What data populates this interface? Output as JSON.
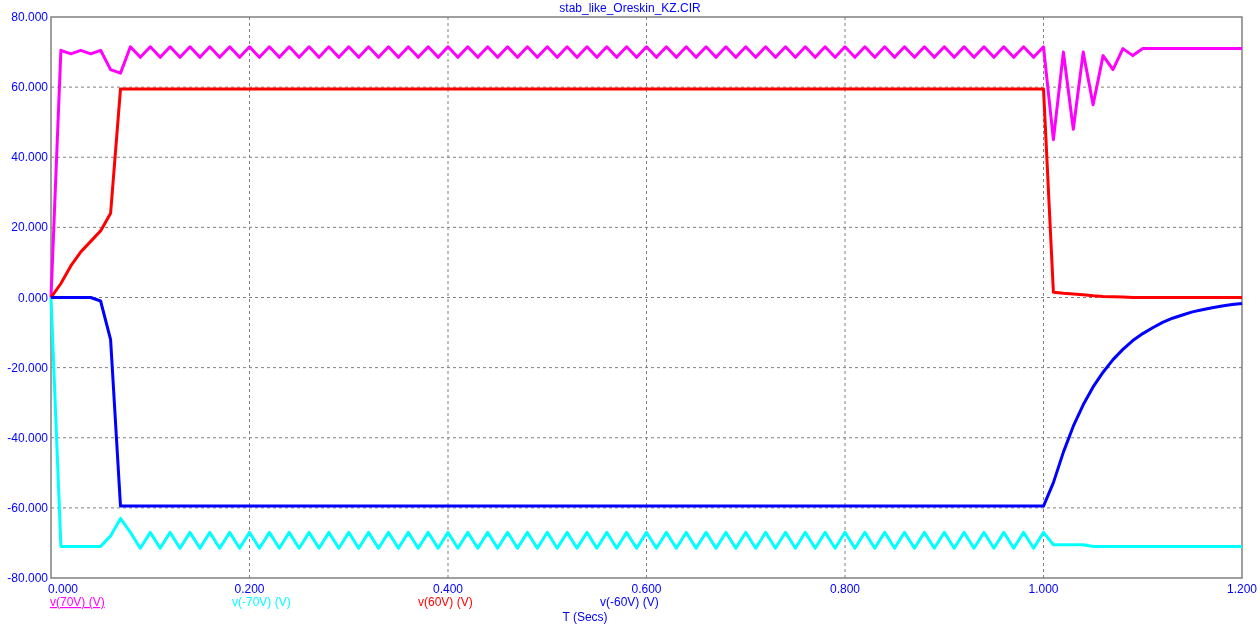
{
  "chart": {
    "chart_data": {
      "type": "line",
      "title": "stab_like_Oreskin_KZ.CIR",
      "xlabel": "T (Secs)",
      "x": [
        0,
        0.01,
        0.02,
        0.03,
        0.04,
        0.05,
        0.06,
        0.07,
        0.08,
        0.09,
        0.1,
        0.11,
        0.12,
        0.13,
        0.14,
        0.15,
        0.16,
        0.17,
        0.18,
        0.19,
        0.2,
        0.21,
        0.22,
        0.23,
        0.24,
        0.25,
        0.26,
        0.27,
        0.28,
        0.29,
        0.3,
        0.31,
        0.32,
        0.33,
        0.34,
        0.35,
        0.36,
        0.37,
        0.38,
        0.39,
        0.4,
        0.41,
        0.42,
        0.43,
        0.44,
        0.45,
        0.46,
        0.47,
        0.48,
        0.49,
        0.5,
        0.51,
        0.52,
        0.53,
        0.54,
        0.55,
        0.56,
        0.57,
        0.58,
        0.59,
        0.6,
        0.61,
        0.62,
        0.63,
        0.64,
        0.65,
        0.66,
        0.67,
        0.68,
        0.69,
        0.7,
        0.71,
        0.72,
        0.73,
        0.74,
        0.75,
        0.76,
        0.77,
        0.78,
        0.79,
        0.8,
        0.81,
        0.82,
        0.83,
        0.84,
        0.85,
        0.86,
        0.87,
        0.88,
        0.89,
        0.9,
        0.91,
        0.92,
        0.93,
        0.94,
        0.95,
        0.96,
        0.97,
        0.98,
        0.99,
        1.0,
        1.01,
        1.02,
        1.03,
        1.04,
        1.05,
        1.06,
        1.07,
        1.08,
        1.09,
        1.1,
        1.11,
        1.12,
        1.13,
        1.14,
        1.15,
        1.16,
        1.17,
        1.18,
        1.19,
        1.2
      ],
      "series": [
        {
          "name": "v(70V) (V)",
          "color": "#ff00ff",
          "values": [
            0,
            70.5,
            69.5,
            70.5,
            69.5,
            70.5,
            65,
            64,
            71.5,
            68.5,
            71.5,
            68.5,
            71.5,
            68.5,
            71.5,
            68.5,
            71.5,
            68.5,
            71.5,
            68.5,
            71.5,
            68.5,
            71.5,
            68.5,
            71.5,
            68.5,
            71.5,
            68.5,
            71.5,
            68.5,
            71.5,
            68.5,
            71.5,
            68.5,
            71.5,
            68.5,
            71.5,
            68.5,
            71.5,
            68.5,
            71.5,
            68.5,
            71.5,
            68.5,
            71.5,
            68.5,
            71.5,
            68.5,
            71.5,
            68.5,
            71.5,
            68.5,
            71.5,
            68.5,
            71.5,
            68.5,
            71.5,
            68.5,
            71.5,
            68.5,
            71.5,
            68.5,
            71.5,
            68.5,
            71.5,
            68.5,
            71.5,
            68.5,
            71.5,
            68.5,
            71.5,
            68.5,
            71.5,
            68.5,
            71.5,
            68.5,
            71.5,
            68.5,
            71.5,
            68.5,
            71.5,
            68.5,
            71.5,
            68.5,
            71.5,
            68.5,
            71.5,
            68.5,
            71.5,
            68.5,
            71.5,
            68.5,
            71.5,
            68.5,
            71.5,
            68.5,
            71.5,
            68.5,
            71.5,
            68.5,
            71.5,
            45,
            70,
            48,
            70,
            55,
            69,
            65,
            71,
            69,
            71,
            71,
            71,
            71,
            71,
            71,
            71,
            71,
            71,
            71,
            71
          ]
        },
        {
          "name": "v(-70V) (V)",
          "color": "#00ffff",
          "values": [
            0,
            -71,
            -71,
            -71,
            -71,
            -71,
            -68,
            -63,
            -67,
            -71.5,
            -67,
            -71.5,
            -67,
            -71.5,
            -67,
            -71.5,
            -67,
            -71.5,
            -67,
            -71.5,
            -67,
            -71.5,
            -67,
            -71.5,
            -67,
            -71.5,
            -67,
            -71.5,
            -67,
            -71.5,
            -67,
            -71.5,
            -67,
            -71.5,
            -67,
            -71.5,
            -67,
            -71.5,
            -67,
            -71.5,
            -67,
            -71.5,
            -67,
            -71.5,
            -67,
            -71.5,
            -67,
            -71.5,
            -67,
            -71.5,
            -67,
            -71.5,
            -67,
            -71.5,
            -67,
            -71.5,
            -67,
            -71.5,
            -67,
            -71.5,
            -67,
            -71.5,
            -67,
            -71.5,
            -67,
            -71.5,
            -67,
            -71.5,
            -67,
            -71.5,
            -67,
            -71.5,
            -67,
            -71.5,
            -67,
            -71.5,
            -67,
            -71.5,
            -67,
            -71.5,
            -67,
            -71.5,
            -67,
            -71.5,
            -67,
            -71.5,
            -67,
            -71.5,
            -67,
            -71.5,
            -67,
            -71.5,
            -67,
            -71.5,
            -67,
            -71.5,
            -67,
            -71.5,
            -67,
            -71.5,
            -67,
            -70.5,
            -70.5,
            -70.5,
            -70.5,
            -71,
            -71,
            -71,
            -71,
            -71,
            -71,
            -71,
            -71,
            -71,
            -71,
            -71,
            -71,
            -71,
            -71,
            -71,
            -71
          ]
        },
        {
          "name": "v(60V) (V)",
          "color": "#ff0000",
          "values": [
            0,
            4,
            9,
            13,
            16,
            19,
            24,
            59.5,
            59.5,
            59.5,
            59.5,
            59.5,
            59.5,
            59.5,
            59.5,
            59.5,
            59.5,
            59.5,
            59.5,
            59.5,
            59.5,
            59.5,
            59.5,
            59.5,
            59.5,
            59.5,
            59.5,
            59.5,
            59.5,
            59.5,
            59.5,
            59.5,
            59.5,
            59.5,
            59.5,
            59.5,
            59.5,
            59.5,
            59.5,
            59.5,
            59.5,
            59.5,
            59.5,
            59.5,
            59.5,
            59.5,
            59.5,
            59.5,
            59.5,
            59.5,
            59.5,
            59.5,
            59.5,
            59.5,
            59.5,
            59.5,
            59.5,
            59.5,
            59.5,
            59.5,
            59.5,
            59.5,
            59.5,
            59.5,
            59.5,
            59.5,
            59.5,
            59.5,
            59.5,
            59.5,
            59.5,
            59.5,
            59.5,
            59.5,
            59.5,
            59.5,
            59.5,
            59.5,
            59.5,
            59.5,
            59.5,
            59.5,
            59.5,
            59.5,
            59.5,
            59.5,
            59.5,
            59.5,
            59.5,
            59.5,
            59.5,
            59.5,
            59.5,
            59.5,
            59.5,
            59.5,
            59.5,
            59.5,
            59.5,
            59.5,
            59.5,
            1.5,
            1.2,
            1,
            0.8,
            0.5,
            0.3,
            0.2,
            0.1,
            0,
            0,
            0,
            0,
            0,
            0,
            0,
            0,
            0,
            0,
            0,
            0
          ]
        },
        {
          "name": "v(-60V) (V)",
          "color": "#0000ff",
          "values": [
            0,
            0,
            0,
            0,
            0,
            -1,
            -12,
            -59.5,
            -59.5,
            -59.5,
            -59.5,
            -59.5,
            -59.5,
            -59.5,
            -59.5,
            -59.5,
            -59.5,
            -59.5,
            -59.5,
            -59.5,
            -59.5,
            -59.5,
            -59.5,
            -59.5,
            -59.5,
            -59.5,
            -59.5,
            -59.5,
            -59.5,
            -59.5,
            -59.5,
            -59.5,
            -59.5,
            -59.5,
            -59.5,
            -59.5,
            -59.5,
            -59.5,
            -59.5,
            -59.5,
            -59.5,
            -59.5,
            -59.5,
            -59.5,
            -59.5,
            -59.5,
            -59.5,
            -59.5,
            -59.5,
            -59.5,
            -59.5,
            -59.5,
            -59.5,
            -59.5,
            -59.5,
            -59.5,
            -59.5,
            -59.5,
            -59.5,
            -59.5,
            -59.5,
            -59.5,
            -59.5,
            -59.5,
            -59.5,
            -59.5,
            -59.5,
            -59.5,
            -59.5,
            -59.5,
            -59.5,
            -59.5,
            -59.5,
            -59.5,
            -59.5,
            -59.5,
            -59.5,
            -59.5,
            -59.5,
            -59.5,
            -59.5,
            -59.5,
            -59.5,
            -59.5,
            -59.5,
            -59.5,
            -59.5,
            -59.5,
            -59.5,
            -59.5,
            -59.5,
            -59.5,
            -59.5,
            -59.5,
            -59.5,
            -59.5,
            -59.5,
            -59.5,
            -59.5,
            -59.5,
            -59.5,
            -52.8,
            -44.1,
            -36.7,
            -30.6,
            -25.5,
            -21.3,
            -17.7,
            -14.8,
            -12.3,
            -10.3,
            -8.6,
            -7.1,
            -5.9,
            -5.0,
            -4.1,
            -3.5,
            -2.9,
            -2.4,
            -2.0,
            -1.7
          ]
        }
      ],
      "xlim": [
        0,
        1.2
      ],
      "ylim": [
        -80,
        80
      ],
      "grid": true,
      "xticks": [
        {
          "value": 0,
          "label": "0.000"
        },
        {
          "value": 0.2,
          "label": "0.200"
        },
        {
          "value": 0.4,
          "label": "0.400"
        },
        {
          "value": 0.6,
          "label": "0.600"
        },
        {
          "value": 0.8,
          "label": "0.800"
        },
        {
          "value": 1.0,
          "label": "1.000"
        },
        {
          "value": 1.2,
          "label": "1.200"
        }
      ],
      "yticks": [
        {
          "value": -80,
          "label": "-80.000"
        },
        {
          "value": -60,
          "label": "-60.000"
        },
        {
          "value": -40,
          "label": "-40.000"
        },
        {
          "value": -20,
          "label": "-20.000"
        },
        {
          "value": 0,
          "label": "0.000"
        },
        {
          "value": 20,
          "label": "20.000"
        },
        {
          "value": 40,
          "label": "40.000"
        },
        {
          "value": 60,
          "label": "60.000"
        },
        {
          "value": 80,
          "label": "80.000"
        }
      ]
    },
    "legend": [
      {
        "selected": true
      },
      {
        "selected": false
      },
      {
        "selected": false
      },
      {
        "selected": false
      }
    ]
  }
}
